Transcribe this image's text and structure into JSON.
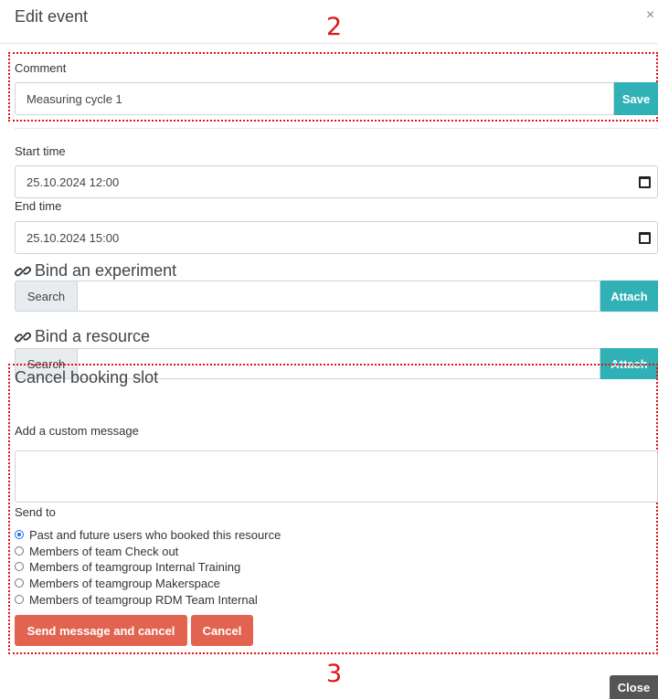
{
  "header": {
    "title": "Edit event",
    "close_glyph": "×"
  },
  "annotations": {
    "top": "2",
    "bottom": "3"
  },
  "comment": {
    "label": "Comment",
    "value": "Measuring cycle 1",
    "save_label": "Save"
  },
  "start": {
    "label": "Start time",
    "value": "25.10.2024 12:00"
  },
  "end": {
    "label": "End time",
    "value": "25.10.2024 15:00"
  },
  "bind_experiment": {
    "title": "Bind an experiment",
    "search_label": "Search",
    "attach_label": "Attach",
    "icon": "link-icon"
  },
  "bind_resource": {
    "title": "Bind a resource",
    "search_label": "Search",
    "attach_label": "Attach",
    "icon": "link-icon"
  },
  "cancel": {
    "title": "Cancel booking slot",
    "message_label": "Add a custom message",
    "send_to_label": "Send to",
    "options": [
      "Past and future users who booked this resource",
      "Members of team Check out",
      "Members of teamgroup Internal Training",
      "Members of teamgroup Makerspace",
      "Members of teamgroup RDM Team Internal"
    ],
    "selected_index": 0,
    "send_cancel_label": "Send message and cancel",
    "cancel_label": "Cancel"
  },
  "footer": {
    "close_label": "Close"
  },
  "colors": {
    "accent_teal": "#2fb1b6",
    "danger_red": "#e2634f",
    "annotation_red": "#e01414"
  }
}
